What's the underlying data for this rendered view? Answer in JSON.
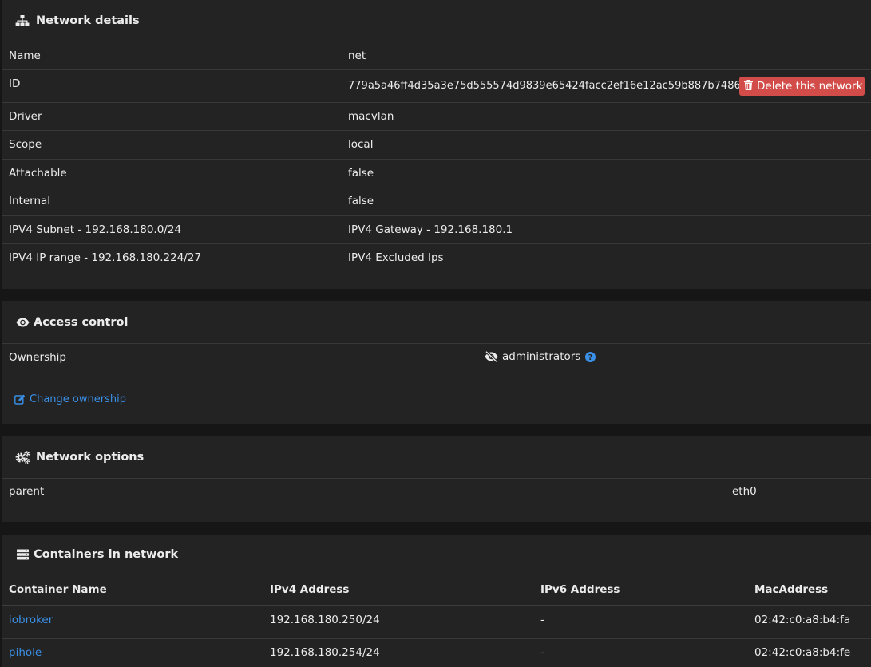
{
  "network_details": {
    "title": "Network details",
    "rows": [
      {
        "label": "Name",
        "value": "net"
      },
      {
        "label": "ID",
        "value": "779a5a46ff4d35a3e75d555574d9839e65424facc2ef16e12ac59b887b74860c"
      },
      {
        "label": "Driver",
        "value": "macvlan"
      },
      {
        "label": "Scope",
        "value": "local"
      },
      {
        "label": "Attachable",
        "value": "false"
      },
      {
        "label": "Internal",
        "value": "false"
      },
      {
        "label": "IPV4 Subnet - 192.168.180.0/24",
        "value": "IPV4 Gateway - 192.168.180.1"
      },
      {
        "label": "IPV4 IP range - 192.168.180.224/27",
        "value": "IPV4 Excluded Ips"
      }
    ],
    "delete_label": "Delete this network"
  },
  "access_control": {
    "title": "Access control",
    "ownership_label": "Ownership",
    "ownership_value": "administrators",
    "change_label": "Change ownership"
  },
  "network_options": {
    "title": "Network options",
    "rows": [
      {
        "key": "parent",
        "value": "eth0"
      }
    ]
  },
  "containers": {
    "title": "Containers in network",
    "columns": [
      "Container Name",
      "IPv4 Address",
      "IPv6 Address",
      "MacAddress"
    ],
    "rows": [
      {
        "name": "iobroker",
        "ipv4": "192.168.180.250/24",
        "ipv6": "-",
        "mac": "02:42:c0:a8:b4:fa"
      },
      {
        "name": "pihole",
        "ipv4": "192.168.180.254/24",
        "ipv6": "-",
        "mac": "02:42:c0:a8:b4:fe"
      }
    ]
  },
  "colors": {
    "background": "#161616",
    "panel": "#232323",
    "link": "#3a8fe6",
    "danger": "#d24d4a",
    "help": "#3a8fe6"
  },
  "icons": [
    "sitemap-icon",
    "eye-icon",
    "trash-icon",
    "eye-slash-icon",
    "question-circle-icon",
    "edit-icon",
    "cogs-icon",
    "server-icon"
  ]
}
